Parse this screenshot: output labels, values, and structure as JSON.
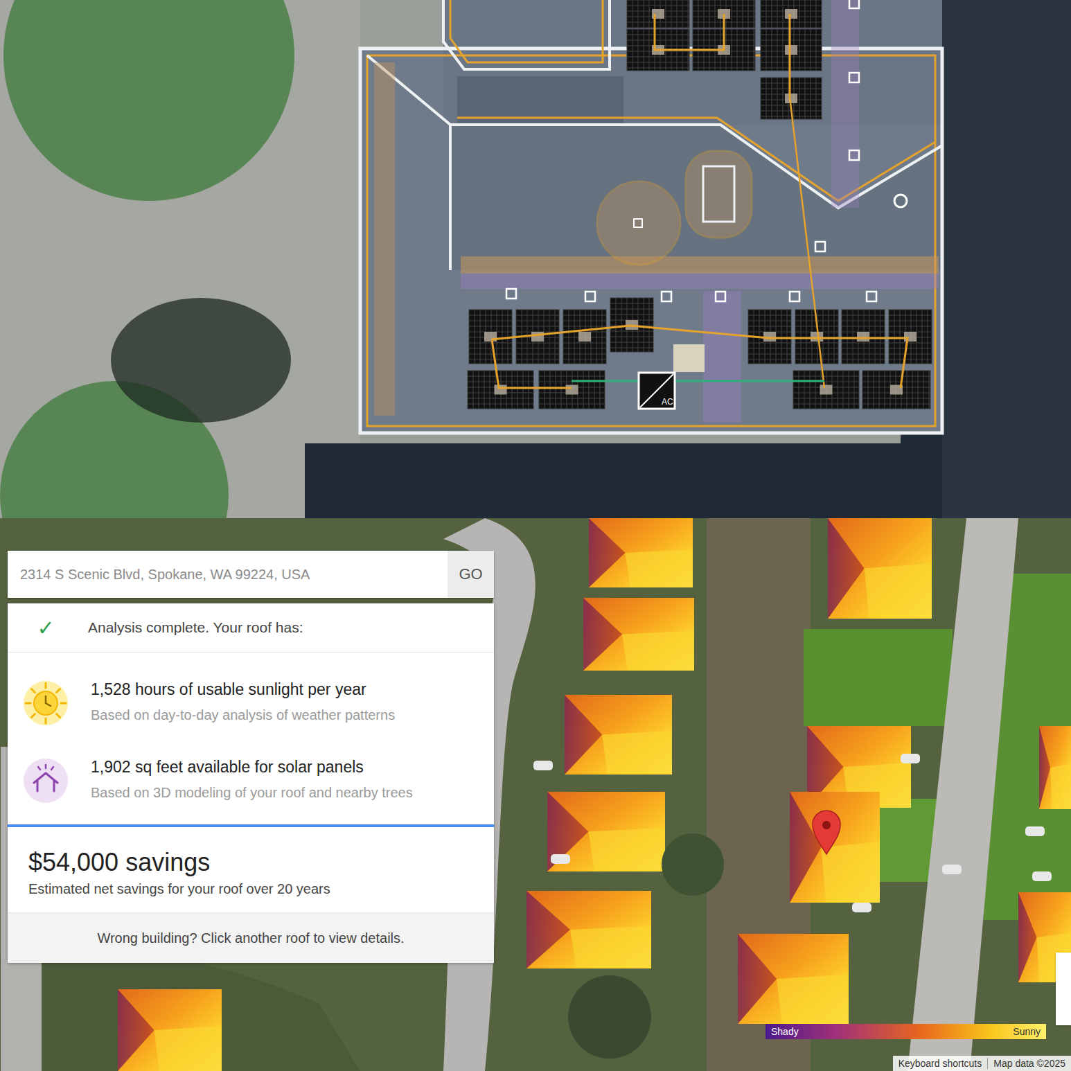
{
  "design": {
    "inverter_label": "AC"
  },
  "search": {
    "value": "2314 S Scenic Blvd, Spokane, WA 99224, USA",
    "button": "GO"
  },
  "analysis": {
    "check": "✓",
    "title": "Analysis complete. Your roof has:",
    "stats": [
      {
        "kind": "sun",
        "headline": "1,528 hours of usable sunlight per year",
        "detail": "Based on day-to-day analysis of weather patterns"
      },
      {
        "kind": "house",
        "headline": "1,902 sq feet available for solar panels",
        "detail": "Based on 3D modeling of your roof and nearby trees"
      }
    ]
  },
  "savings": {
    "amount": "$54,000 savings",
    "caption": "Estimated net savings for your roof over 20 years"
  },
  "footer": "Wrong building? Click another roof to view details.",
  "legend": {
    "low": "Shady",
    "high": "Sunny"
  },
  "attribution": [
    "Keyboard shortcuts",
    "Map data ©2025"
  ]
}
